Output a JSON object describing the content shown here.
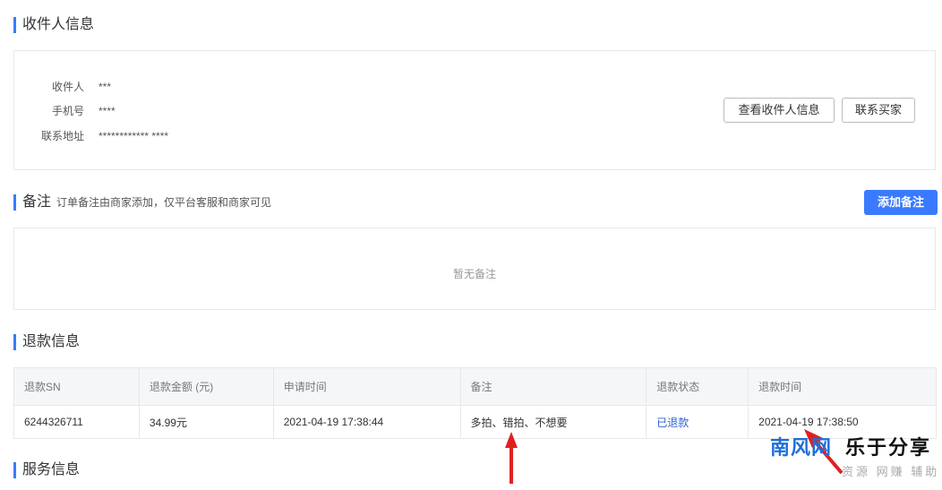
{
  "recipient": {
    "title": "收件人信息",
    "rows": [
      {
        "label": "收件人",
        "value": "***"
      },
      {
        "label": "手机号",
        "value": "****"
      },
      {
        "label": "联系地址",
        "value": "************ ****"
      }
    ],
    "view_button": "查看收件人信息",
    "contact_button": "联系买家"
  },
  "notes": {
    "title": "备注",
    "subtitle": "订单备注由商家添加，仅平台客服和商家可见",
    "add_button": "添加备注",
    "empty_text": "暂无备注"
  },
  "refund": {
    "title": "退款信息",
    "columns": [
      "退款SN",
      "退款金额 (元)",
      "申请时间",
      "备注",
      "退款状态",
      "退款时间"
    ],
    "rows": [
      [
        "6244326711",
        "34.99元",
        "2021-04-19 17:38:44",
        "多拍、错拍、不想要",
        "已退款",
        "2021-04-19 17:38:50"
      ]
    ]
  },
  "service": {
    "title": "服务信息"
  },
  "watermark": {
    "brand": "南风网",
    "slogan": "乐于分享",
    "tagline": "资源 网赚 辅助"
  },
  "colors": {
    "accent": "#3a7afe",
    "annotation_arrow": "#e02020",
    "status_link": "#2f5fd0"
  }
}
